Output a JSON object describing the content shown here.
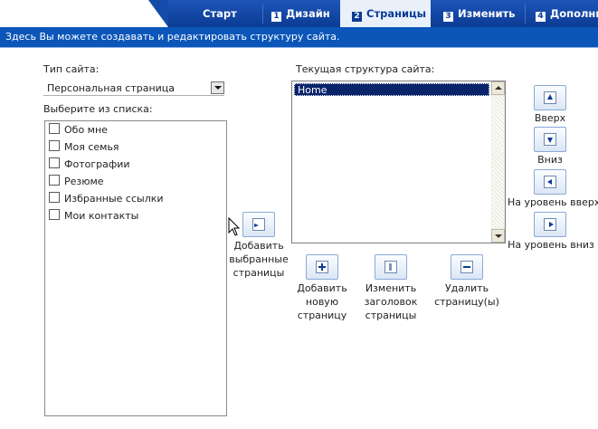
{
  "tabs": [
    {
      "num": "",
      "label": "Старт",
      "active": false
    },
    {
      "num": "1",
      "label": "Дизайн",
      "active": false
    },
    {
      "num": "2",
      "label": "Страницы",
      "active": true
    },
    {
      "num": "3",
      "label": "Изменить",
      "active": false
    },
    {
      "num": "4",
      "label": "Дополни",
      "active": false
    }
  ],
  "info_text": "Здесь Вы можете создавать и редактировать структуру сайта.",
  "left": {
    "site_type_label": "Тип сайта:",
    "site_type_value": "Персональная страница",
    "choose_label": "Выберите из списка:",
    "items": [
      {
        "label": "Обо мне",
        "checked": false
      },
      {
        "label": "Моя семья",
        "checked": false
      },
      {
        "label": "Фотографии",
        "checked": false
      },
      {
        "label": "Резюме",
        "checked": false
      },
      {
        "label": "Избранные ссылки",
        "checked": false
      },
      {
        "label": "Мои контакты",
        "checked": false
      }
    ]
  },
  "add_selected": {
    "line1": "Добавить",
    "line2": "выбранные",
    "line3": "страницы"
  },
  "structure": {
    "label": "Текущая структура сайта:",
    "items": [
      "Home"
    ],
    "selected": "Home"
  },
  "actions": {
    "new_page": {
      "line1": "Добавить",
      "line2": "новую",
      "line3": "страницу"
    },
    "rename": {
      "line1": "Изменить",
      "line2": "заголовок",
      "line3": "страницы"
    },
    "delete": {
      "line1": "Удалить",
      "line2": "страницу(ы)"
    }
  },
  "move": {
    "up": "Вверх",
    "down": "Вниз",
    "level_up": "На уровень вверх",
    "level_down": "На уровень вниз"
  },
  "colors": {
    "tab_bar": "#0b3b94",
    "info_bar": "#0b56b8",
    "selection": "#0a246a",
    "button_border": "#8aa9d6"
  }
}
